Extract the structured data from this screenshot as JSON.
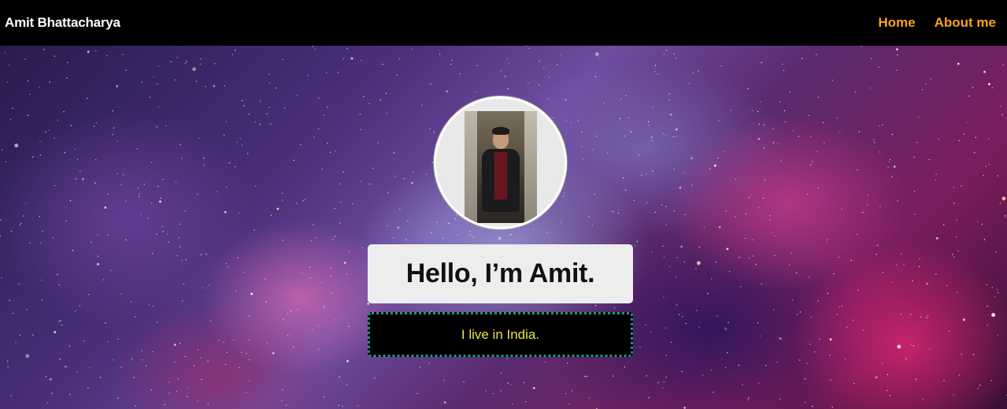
{
  "navbar": {
    "brand": "Amit Bhattacharya",
    "links": [
      {
        "label": "Home"
      },
      {
        "label": "About me"
      }
    ],
    "link_color": "#f7a21b"
  },
  "hero": {
    "greeting": "Hello, I’m Amit.",
    "location": "I live in India.",
    "location_color": "#e6e64a",
    "border_color": "#1a9a8a"
  }
}
